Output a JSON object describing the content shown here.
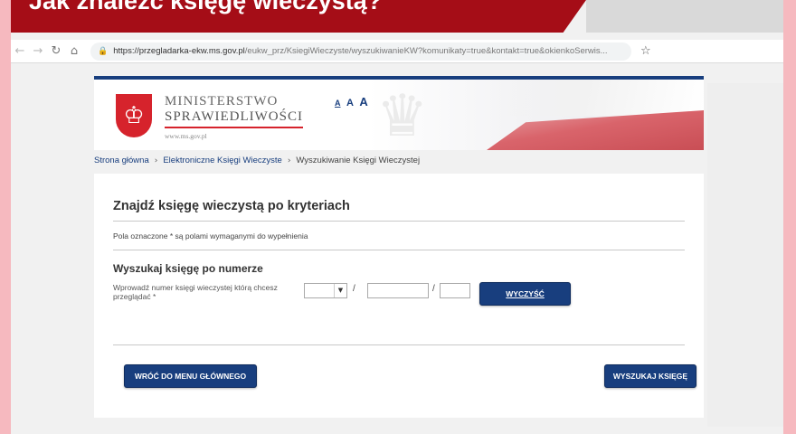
{
  "banner": {
    "title": "Jak znaleźć księgę wieczystą?"
  },
  "browser": {
    "url_host": "https://przegladarka-ekw.ms.gov.pl",
    "url_path": "/eukw_prz/KsiegiWieczyste/wyszukiwanieKW?komunikaty=true&kontakt=true&okienkoSerwis..."
  },
  "header": {
    "ministry_line1": "MINISTERSTWO",
    "ministry_line2": "SPRAWIEDLIWOŚCI",
    "ministry_url": "www.ms.gov.pl",
    "font_size_options": [
      "A",
      "A",
      "A"
    ]
  },
  "breadcrumb": {
    "items": [
      "Strona główna",
      "Elektroniczne Księgi Wieczyste",
      "Wyszukiwanie Księgi Wieczystej"
    ]
  },
  "form": {
    "title": "Znajdź księgę wieczystą po kryteriach",
    "required_note": "Pola oznaczone * są polami wymaganymi do wypełnienia",
    "section_title": "Wyszukaj księgę po numerze",
    "number_label": "Wprowadź numer księgi wieczystej którą chcesz przeglądać *",
    "separator": "/",
    "court_code_value": "",
    "book_number_value": "",
    "check_digit_value": "",
    "clear_button": "WYCZYŚĆ",
    "back_button": "WRÓĆ DO MENU GŁÓWNEGO",
    "search_button": "WYSZUKAJ KSIĘGĘ"
  },
  "colors": {
    "banner_red": "#a50d17",
    "brand_navy": "#183e7e",
    "emblem_red": "#d6232c",
    "outer_pink": "#f6b9bf"
  },
  "icons": {
    "back": "arrow-left-icon",
    "forward": "arrow-right-icon",
    "reload": "reload-icon",
    "home": "home-icon",
    "lock": "lock-icon",
    "bookmark": "star-icon",
    "dropdown": "caret-down-icon",
    "emblem": "eagle-emblem-icon"
  }
}
